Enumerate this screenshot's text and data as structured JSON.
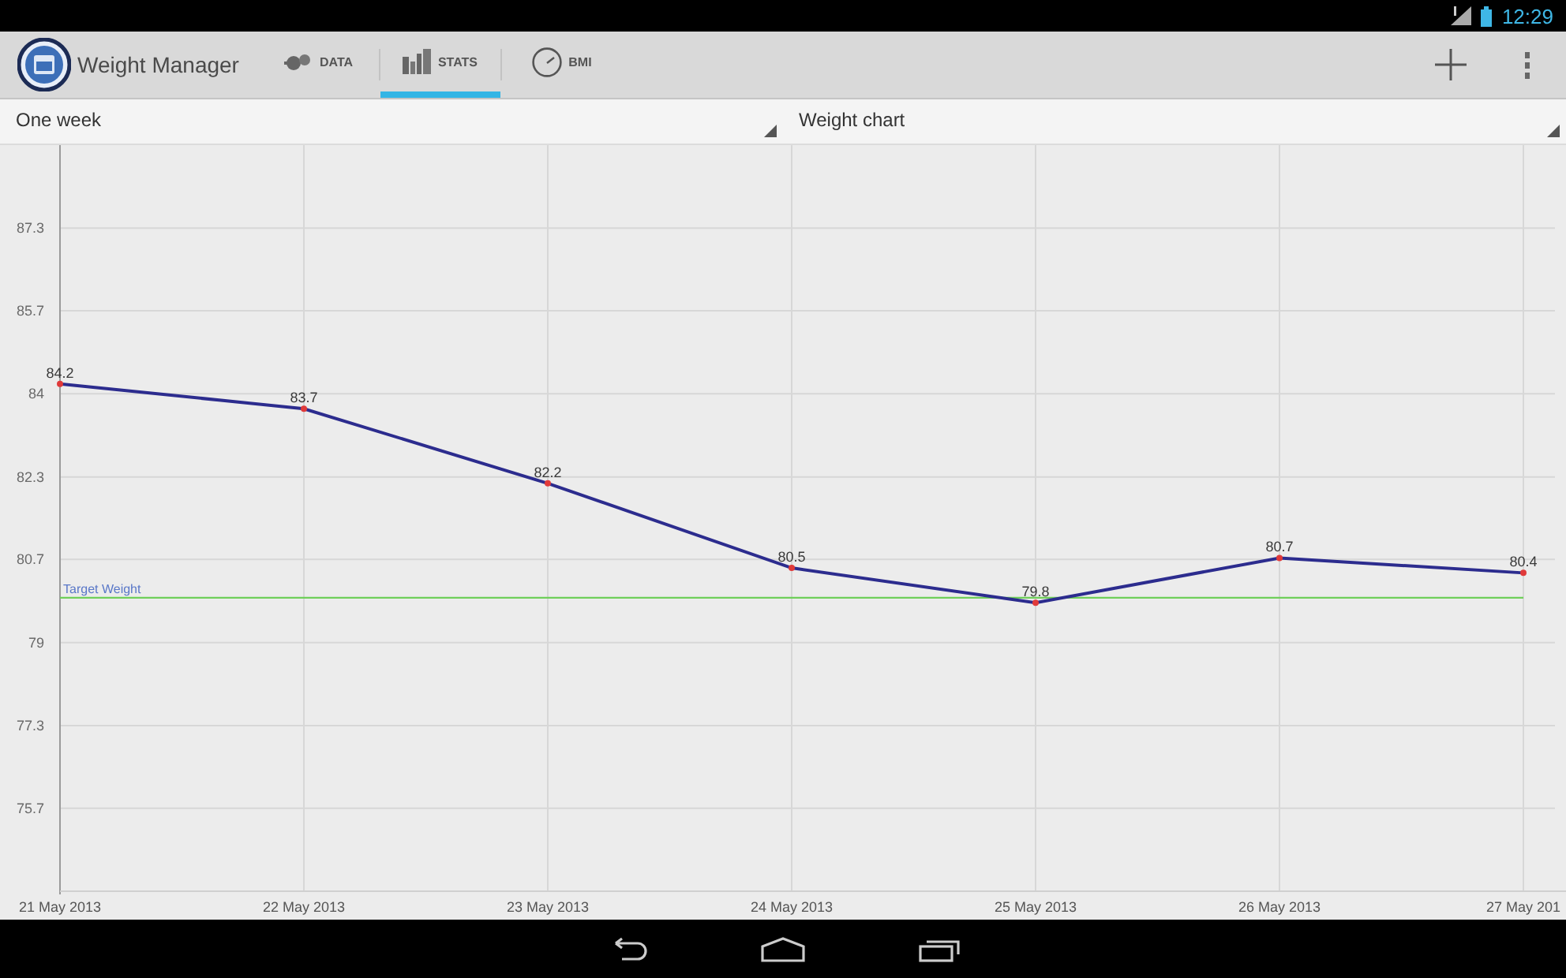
{
  "status_bar": {
    "time": "12:29"
  },
  "action_bar": {
    "title": "Weight Manager",
    "tabs": [
      {
        "label": "DATA",
        "selected": false
      },
      {
        "label": "STATS",
        "selected": true
      },
      {
        "label": "BMI",
        "selected": false
      }
    ]
  },
  "spinners": [
    {
      "value": "One week"
    },
    {
      "value": "Weight chart"
    }
  ],
  "chart": {
    "chart_data": {
      "type": "line",
      "grid": true,
      "categories": [
        "21 May 2013",
        "22 May 2013",
        "23 May 2013",
        "24 May 2013",
        "25 May 2013",
        "26 May 2013",
        "27 May 201"
      ],
      "series": [
        {
          "color": "#2c2c8e",
          "marker": "circle",
          "values": [
            84.2,
            83.7,
            82.2,
            80.5,
            79.8,
            80.7,
            80.4
          ]
        }
      ],
      "ylim": [
        74,
        89
      ],
      "yticks": [
        {
          "value": 75.67,
          "label": "75.7"
        },
        {
          "value": 77.33,
          "label": "77.3"
        },
        79,
        {
          "value": 80.67,
          "label": "80.7"
        },
        {
          "value": 82.33,
          "label": "82.3"
        },
        84,
        {
          "value": 85.67,
          "label": "85.7"
        },
        {
          "value": 87.33,
          "label": "87.3"
        }
      ],
      "data_labels": true,
      "ref_lines": [
        {
          "axis": "y",
          "value": 79.9,
          "label": "Target Weight",
          "color": "#6fcf5a"
        }
      ]
    }
  }
}
